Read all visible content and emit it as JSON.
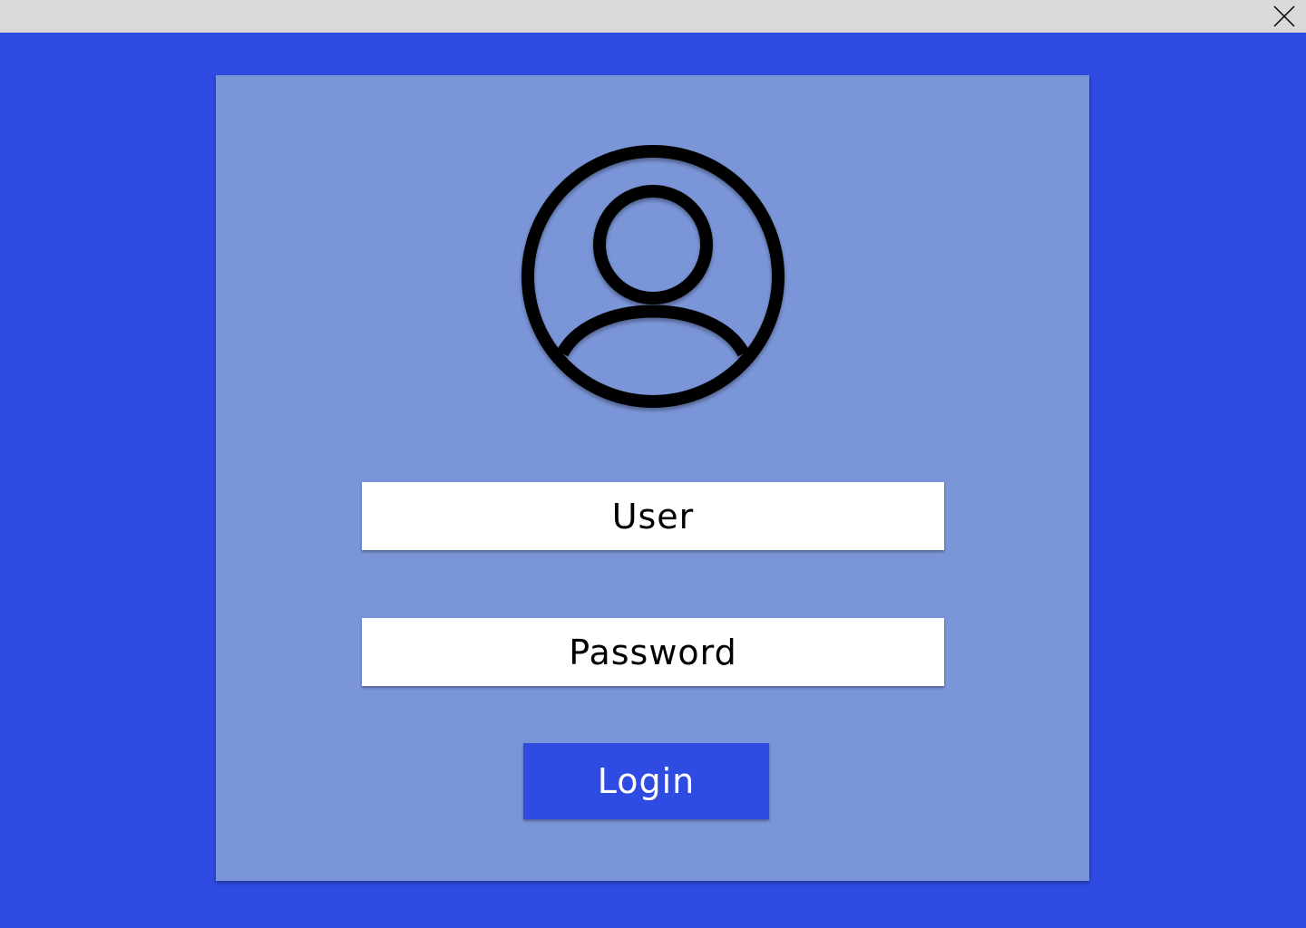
{
  "window": {
    "close_icon": "close-icon",
    "titlebar_color": "#d9d9d9"
  },
  "theme": {
    "background": "#2e4be2",
    "card": "#7b96d8",
    "button": "#2e4be2"
  },
  "login_form": {
    "avatar_icon": "user-avatar-icon",
    "user_placeholder": "User",
    "password_placeholder": "Password",
    "login_label": "Login"
  }
}
